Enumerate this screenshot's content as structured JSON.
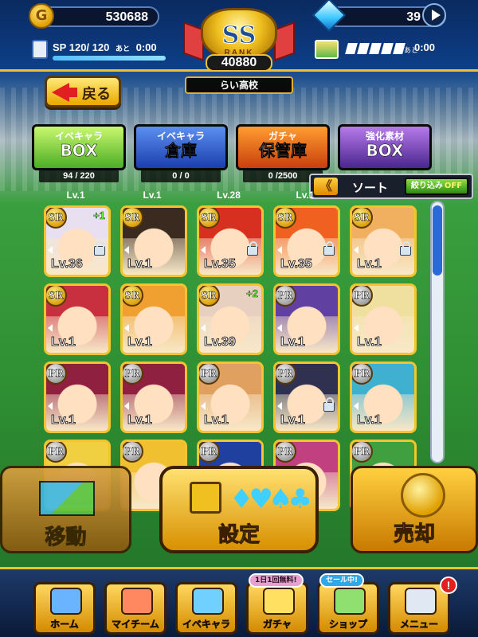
{
  "top": {
    "coins": "530688",
    "gems": "39",
    "sp_label": "SP",
    "sp_value": "120/ 120",
    "sp_ato": "あと",
    "sp_time": "0:00",
    "sp_fill_fraction": 1.0,
    "stamina_ato": "あと",
    "stamina_time": "0:00"
  },
  "rank": {
    "grade": "SS",
    "label": "RANK",
    "score": "40880"
  },
  "school_name": "らい高校",
  "back_label": "戻る",
  "tabs": [
    {
      "line1": "イベキャラ",
      "line2": "BOX",
      "count": "94 / 220",
      "color": "#4cae24"
    },
    {
      "line1": "イベキャラ",
      "line2": "倉庫",
      "count": "0 / 0",
      "color": "#1b3fae"
    },
    {
      "line1": "ガチャ",
      "line2": "保管庫",
      "count": "0 /2500",
      "color": "#c8400c"
    },
    {
      "line1": "強化素材",
      "line2": "BOX",
      "count": "",
      "color": "#4a2690"
    }
  ],
  "sort": {
    "chevrons": "《",
    "label": "ソート",
    "filter_label": "絞り込み",
    "filter_state": "OFF"
  },
  "prev_row_levels": [
    "Lv.1",
    "Lv.1",
    "Lv.28",
    "Lv.1",
    ""
  ],
  "cards": [
    {
      "rarity": "SR",
      "level": "Lv.36",
      "plus": "+1",
      "locked": true,
      "bg": "#e8e0f0"
    },
    {
      "rarity": "SR",
      "level": "Lv.1",
      "plus": "",
      "locked": false,
      "bg": "#3a2a20"
    },
    {
      "rarity": "SR",
      "level": "Lv.35",
      "plus": "",
      "locked": true,
      "bg": "#d83020"
    },
    {
      "rarity": "SR",
      "level": "Lv.35",
      "plus": "",
      "locked": true,
      "bg": "#f06020"
    },
    {
      "rarity": "SR",
      "level": "Lv.1",
      "plus": "",
      "locked": true,
      "bg": "#f0b060"
    },
    {
      "rarity": "SR",
      "level": "Lv.1",
      "plus": "",
      "locked": false,
      "bg": "#c83040"
    },
    {
      "rarity": "SR",
      "level": "Lv.1",
      "plus": "",
      "locked": false,
      "bg": "#f0a030"
    },
    {
      "rarity": "SR",
      "level": "Lv.39",
      "plus": "+2",
      "locked": false,
      "bg": "#e8d0c0"
    },
    {
      "rarity": "PR",
      "level": "Lv.1",
      "plus": "",
      "locked": false,
      "bg": "#6040a0"
    },
    {
      "rarity": "PR",
      "level": "Lv.1",
      "plus": "",
      "locked": false,
      "bg": "#f0e0a0"
    },
    {
      "rarity": "PR",
      "level": "Lv.1",
      "plus": "",
      "locked": false,
      "bg": "#902040"
    },
    {
      "rarity": "PR",
      "level": "Lv.1",
      "plus": "",
      "locked": false,
      "bg": "#902040"
    },
    {
      "rarity": "PR",
      "level": "Lv.1",
      "plus": "",
      "locked": false,
      "bg": "#e0a060"
    },
    {
      "rarity": "PR",
      "level": "Lv.1",
      "plus": "",
      "locked": true,
      "bg": "#303050"
    },
    {
      "rarity": "PR",
      "level": "Lv.1",
      "plus": "",
      "locked": false,
      "bg": "#40b0d0"
    },
    {
      "rarity": "PR",
      "level": "",
      "plus": "",
      "locked": false,
      "bg": "#f0d040"
    },
    {
      "rarity": "PR",
      "level": "",
      "plus": "",
      "locked": false,
      "bg": "#f0c030"
    },
    {
      "rarity": "PR",
      "level": "",
      "plus": "",
      "locked": false,
      "bg": "#2040a0"
    },
    {
      "rarity": "PR",
      "level": "",
      "plus": "",
      "locked": false,
      "bg": "#c04080"
    },
    {
      "rarity": "PR",
      "level": "",
      "plus": "",
      "locked": false,
      "bg": "#40a040"
    }
  ],
  "actions": {
    "move": "移動",
    "lock": "設定",
    "lock_suits": "♦♥♠♣",
    "sell": "売却"
  },
  "nav": [
    {
      "label": "ホーム",
      "icon": "home-icon",
      "badge": ""
    },
    {
      "label": "マイチーム",
      "icon": "team-icon",
      "badge": ""
    },
    {
      "label": "イベキャラ",
      "icon": "event-chara-icon",
      "badge": ""
    },
    {
      "label": "ガチャ",
      "icon": "gacha-icon",
      "badge": "1日1回無料!"
    },
    {
      "label": "ショップ",
      "icon": "shop-icon",
      "badge": "セール中!"
    },
    {
      "label": "メニュー",
      "icon": "menu-icon",
      "badge": "",
      "alert": "!"
    }
  ]
}
